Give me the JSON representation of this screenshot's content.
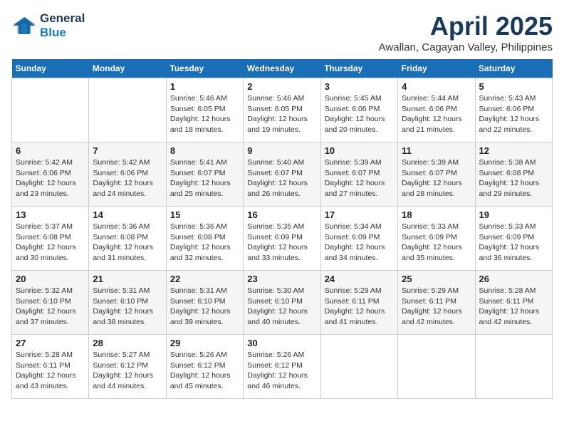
{
  "header": {
    "logo_line1": "General",
    "logo_line2": "Blue",
    "month": "April 2025",
    "location": "Awallan, Cagayan Valley, Philippines"
  },
  "weekdays": [
    "Sunday",
    "Monday",
    "Tuesday",
    "Wednesday",
    "Thursday",
    "Friday",
    "Saturday"
  ],
  "weeks": [
    [
      {
        "day": "",
        "sunrise": "",
        "sunset": "",
        "daylight": ""
      },
      {
        "day": "",
        "sunrise": "",
        "sunset": "",
        "daylight": ""
      },
      {
        "day": "1",
        "sunrise": "Sunrise: 5:46 AM",
        "sunset": "Sunset: 6:05 PM",
        "daylight": "Daylight: 12 hours and 18 minutes."
      },
      {
        "day": "2",
        "sunrise": "Sunrise: 5:46 AM",
        "sunset": "Sunset: 6:05 PM",
        "daylight": "Daylight: 12 hours and 19 minutes."
      },
      {
        "day": "3",
        "sunrise": "Sunrise: 5:45 AM",
        "sunset": "Sunset: 6:06 PM",
        "daylight": "Daylight: 12 hours and 20 minutes."
      },
      {
        "day": "4",
        "sunrise": "Sunrise: 5:44 AM",
        "sunset": "Sunset: 6:06 PM",
        "daylight": "Daylight: 12 hours and 21 minutes."
      },
      {
        "day": "5",
        "sunrise": "Sunrise: 5:43 AM",
        "sunset": "Sunset: 6:06 PM",
        "daylight": "Daylight: 12 hours and 22 minutes."
      }
    ],
    [
      {
        "day": "6",
        "sunrise": "Sunrise: 5:42 AM",
        "sunset": "Sunset: 6:06 PM",
        "daylight": "Daylight: 12 hours and 23 minutes."
      },
      {
        "day": "7",
        "sunrise": "Sunrise: 5:42 AM",
        "sunset": "Sunset: 6:06 PM",
        "daylight": "Daylight: 12 hours and 24 minutes."
      },
      {
        "day": "8",
        "sunrise": "Sunrise: 5:41 AM",
        "sunset": "Sunset: 6:07 PM",
        "daylight": "Daylight: 12 hours and 25 minutes."
      },
      {
        "day": "9",
        "sunrise": "Sunrise: 5:40 AM",
        "sunset": "Sunset: 6:07 PM",
        "daylight": "Daylight: 12 hours and 26 minutes."
      },
      {
        "day": "10",
        "sunrise": "Sunrise: 5:39 AM",
        "sunset": "Sunset: 6:07 PM",
        "daylight": "Daylight: 12 hours and 27 minutes."
      },
      {
        "day": "11",
        "sunrise": "Sunrise: 5:39 AM",
        "sunset": "Sunset: 6:07 PM",
        "daylight": "Daylight: 12 hours and 28 minutes."
      },
      {
        "day": "12",
        "sunrise": "Sunrise: 5:38 AM",
        "sunset": "Sunset: 6:08 PM",
        "daylight": "Daylight: 12 hours and 29 minutes."
      }
    ],
    [
      {
        "day": "13",
        "sunrise": "Sunrise: 5:37 AM",
        "sunset": "Sunset: 6:08 PM",
        "daylight": "Daylight: 12 hours and 30 minutes."
      },
      {
        "day": "14",
        "sunrise": "Sunrise: 5:36 AM",
        "sunset": "Sunset: 6:08 PM",
        "daylight": "Daylight: 12 hours and 31 minutes."
      },
      {
        "day": "15",
        "sunrise": "Sunrise: 5:36 AM",
        "sunset": "Sunset: 6:08 PM",
        "daylight": "Daylight: 12 hours and 32 minutes."
      },
      {
        "day": "16",
        "sunrise": "Sunrise: 5:35 AM",
        "sunset": "Sunset: 6:09 PM",
        "daylight": "Daylight: 12 hours and 33 minutes."
      },
      {
        "day": "17",
        "sunrise": "Sunrise: 5:34 AM",
        "sunset": "Sunset: 6:09 PM",
        "daylight": "Daylight: 12 hours and 34 minutes."
      },
      {
        "day": "18",
        "sunrise": "Sunrise: 5:33 AM",
        "sunset": "Sunset: 6:09 PM",
        "daylight": "Daylight: 12 hours and 35 minutes."
      },
      {
        "day": "19",
        "sunrise": "Sunrise: 5:33 AM",
        "sunset": "Sunset: 6:09 PM",
        "daylight": "Daylight: 12 hours and 36 minutes."
      }
    ],
    [
      {
        "day": "20",
        "sunrise": "Sunrise: 5:32 AM",
        "sunset": "Sunset: 6:10 PM",
        "daylight": "Daylight: 12 hours and 37 minutes."
      },
      {
        "day": "21",
        "sunrise": "Sunrise: 5:31 AM",
        "sunset": "Sunset: 6:10 PM",
        "daylight": "Daylight: 12 hours and 38 minutes."
      },
      {
        "day": "22",
        "sunrise": "Sunrise: 5:31 AM",
        "sunset": "Sunset: 6:10 PM",
        "daylight": "Daylight: 12 hours and 39 minutes."
      },
      {
        "day": "23",
        "sunrise": "Sunrise: 5:30 AM",
        "sunset": "Sunset: 6:10 PM",
        "daylight": "Daylight: 12 hours and 40 minutes."
      },
      {
        "day": "24",
        "sunrise": "Sunrise: 5:29 AM",
        "sunset": "Sunset: 6:11 PM",
        "daylight": "Daylight: 12 hours and 41 minutes."
      },
      {
        "day": "25",
        "sunrise": "Sunrise: 5:29 AM",
        "sunset": "Sunset: 6:11 PM",
        "daylight": "Daylight: 12 hours and 42 minutes."
      },
      {
        "day": "26",
        "sunrise": "Sunrise: 5:28 AM",
        "sunset": "Sunset: 6:11 PM",
        "daylight": "Daylight: 12 hours and 42 minutes."
      }
    ],
    [
      {
        "day": "27",
        "sunrise": "Sunrise: 5:28 AM",
        "sunset": "Sunset: 6:11 PM",
        "daylight": "Daylight: 12 hours and 43 minutes."
      },
      {
        "day": "28",
        "sunrise": "Sunrise: 5:27 AM",
        "sunset": "Sunset: 6:12 PM",
        "daylight": "Daylight: 12 hours and 44 minutes."
      },
      {
        "day": "29",
        "sunrise": "Sunrise: 5:26 AM",
        "sunset": "Sunset: 6:12 PM",
        "daylight": "Daylight: 12 hours and 45 minutes."
      },
      {
        "day": "30",
        "sunrise": "Sunrise: 5:26 AM",
        "sunset": "Sunset: 6:12 PM",
        "daylight": "Daylight: 12 hours and 46 minutes."
      },
      {
        "day": "",
        "sunrise": "",
        "sunset": "",
        "daylight": ""
      },
      {
        "day": "",
        "sunrise": "",
        "sunset": "",
        "daylight": ""
      },
      {
        "day": "",
        "sunrise": "",
        "sunset": "",
        "daylight": ""
      }
    ]
  ]
}
